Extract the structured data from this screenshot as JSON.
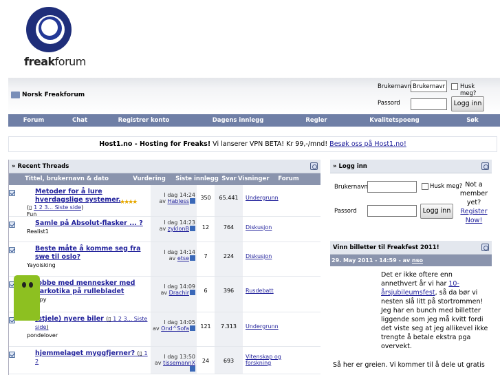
{
  "logo": {
    "text_bold": "freak",
    "text_rest": "forum"
  },
  "breadcrumb": {
    "title": "Norsk Freakforum"
  },
  "top_login": {
    "username_label": "Brukernavn",
    "username_value": "Brukernavn",
    "remember_label": "Husk meg?",
    "password_label": "Passord",
    "submit": "Logg inn"
  },
  "nav": [
    "Forum",
    "Chat",
    "Registrer konto",
    "Dagens innlegg",
    "Regler",
    "Kvalitetspoeng",
    "Søk"
  ],
  "banner": {
    "bold": "Host1.no - Hosting for Freaks!",
    "text": " Vi lanserer VPN BETA! Kr 99,-/mnd! ",
    "link": "Besøk oss på Host1.no!"
  },
  "recent": {
    "title": "» Recent Threads",
    "columns": [
      "Tittel, brukernavn & dato",
      "Vurdering",
      "Siste innlegg",
      "Svar",
      "Visninger",
      "Forum"
    ],
    "rows": [
      {
        "title": "Metoder for å lure hverdagslige systemer.",
        "pages": "1 2 3... Siste side",
        "author": "Fun",
        "rating": 4,
        "when": "I dag",
        "time": "14:24",
        "by": "Habless",
        "replies": "350",
        "views": "65.441",
        "forum": "Undergrunn"
      },
      {
        "title": "Samle på Absolut-flasker ... ?",
        "pages": "",
        "author": "Realist1",
        "rating": 0,
        "when": "I dag",
        "time": "14:23",
        "by": "zyklonB",
        "replies": "12",
        "views": "764",
        "forum": "Diskusjon"
      },
      {
        "title": "Beste måte å komme seg fra swe til oslo?",
        "pages": "",
        "author": "Yayoisking",
        "rating": 0,
        "when": "I dag",
        "time": "14:14",
        "by": "etse",
        "replies": "7",
        "views": "224",
        "forum": "Diskusjon"
      },
      {
        "title": "Jobbe med mennesker med narkotika på rullebladet",
        "pages": "",
        "author": "Kruppy",
        "rating": 0,
        "when": "I dag",
        "time": "14:09",
        "by": "Drachir",
        "replies": "6",
        "views": "396",
        "forum": "Rusdebatt"
      },
      {
        "title": "(stjele) nyere biler",
        "pages": "1 2 3... Siste side",
        "author": "pondelover",
        "rating": 0,
        "when": "I dag",
        "time": "14:05",
        "by": "Ond^Sofa",
        "replies": "121",
        "views": "7.313",
        "forum": "Undergrunn"
      },
      {
        "title": "hjemmelaget myggfjerner?",
        "pages": "1 2",
        "author": "",
        "rating": 0,
        "when": "I dag",
        "time": "13:50",
        "by": "tissemannX",
        "replies": "24",
        "views": "693",
        "forum": "Vitenskap og forskning"
      }
    ]
  },
  "side_login": {
    "title": "» Logg inn",
    "username_label": "Brukernavn",
    "remember_label": "Husk meg?",
    "password_label": "Passord",
    "submit": "Logg inn",
    "not_member_1": "Not a",
    "not_member_2": "member",
    "not_member_3": "yet?",
    "register": "Register Now!"
  },
  "vinn": {
    "title": "Vinn billetter til Freakfest 2011!",
    "date": "29. May 2011 - 14:59 - av",
    "author": "nso",
    "p1a": "Det er ikke oftere enn annethvert år vi har ",
    "p1link": "10-årsjubileumsfest",
    "p1b": ", så da bør vi nesten slå litt på stortrommen!",
    "p2": "Jeg har en bunch med billetter liggende som jeg må kvitt fordi det viste seg at jeg allikevel ikke trengte å betale ekstra pga overvekt.",
    "p3": "Så her er greien. Vi kommer til å dele ut gratis"
  },
  "colors": {
    "nav_bg": "#6f7fa6",
    "link": "#22229c",
    "header_bg": "#8a94ad",
    "star": "#e6a800"
  }
}
